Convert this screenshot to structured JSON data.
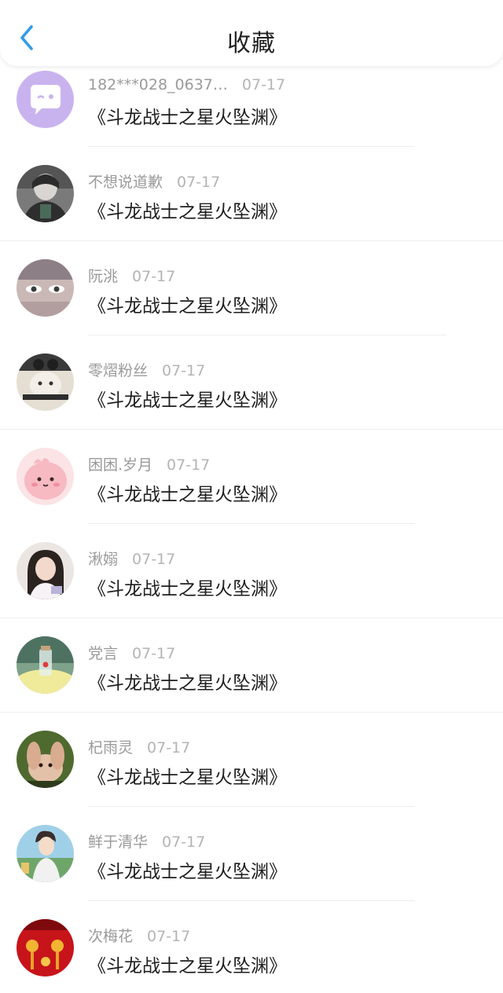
{
  "header": {
    "title": "收藏"
  },
  "favorites": [
    {
      "name": "182***028_0637…",
      "date": "07-17",
      "book": "《斗龙战士之星火坠渊》"
    },
    {
      "name": "不想说道歉",
      "date": "07-17",
      "book": "《斗龙战士之星火坠渊》"
    },
    {
      "name": "阮洮",
      "date": "07-17",
      "book": "《斗龙战士之星火坠渊》"
    },
    {
      "name": "零熠粉丝",
      "date": "07-17",
      "book": "《斗龙战士之星火坠渊》"
    },
    {
      "name": "困困.岁月",
      "date": "07-17",
      "book": "《斗龙战士之星火坠渊》"
    },
    {
      "name": "湫嫋",
      "date": "07-17",
      "book": "《斗龙战士之星火坠渊》"
    },
    {
      "name": "党言",
      "date": "07-17",
      "book": "《斗龙战士之星火坠渊》"
    },
    {
      "name": "杞雨灵",
      "date": "07-17",
      "book": "《斗龙战士之星火坠渊》"
    },
    {
      "name": "鲜于清华",
      "date": "07-17",
      "book": "《斗龙战士之星火坠渊》"
    },
    {
      "name": "次梅花",
      "date": "07-17",
      "book": "《斗龙战士之星火坠渊》"
    }
  ],
  "colors": {
    "accent": "#2f9be8",
    "text_primary": "#1e1e1e",
    "text_secondary": "#9a9a9a"
  },
  "icons": {
    "back": "chevron-left-icon"
  }
}
